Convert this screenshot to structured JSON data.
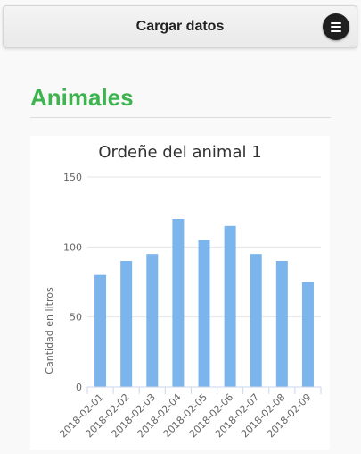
{
  "header": {
    "title": "Cargar datos",
    "menu_icon": "hamburger-menu-icon"
  },
  "page": {
    "title": "Animales"
  },
  "colors": {
    "accent": "#3fb34f",
    "bar": "#7cb5ec"
  },
  "chart_data": {
    "type": "bar",
    "title": "Ordeñe del animal 1",
    "xlabel": "",
    "ylabel": "Cantidad en litros",
    "categories": [
      "2018-02-01",
      "2018-02-02",
      "2018-02-03",
      "2018-02-04",
      "2018-02-05",
      "2018-02-06",
      "2018-02-07",
      "2018-02-08",
      "2018-02-09"
    ],
    "values": [
      80,
      90,
      95,
      120,
      105,
      115,
      95,
      90,
      75
    ],
    "ylim": [
      0,
      150
    ],
    "yticks": [
      0,
      50,
      100,
      150
    ],
    "grid": true
  }
}
